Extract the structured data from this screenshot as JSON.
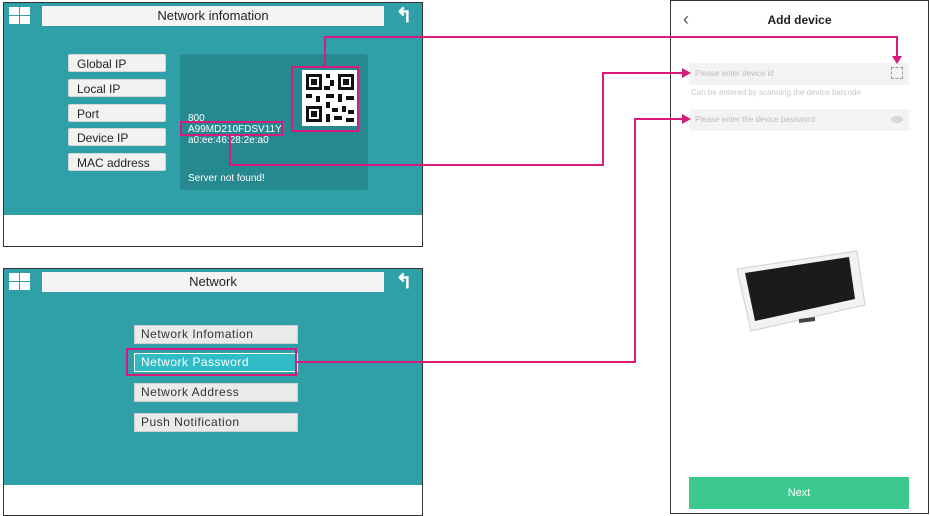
{
  "network_info_screen": {
    "title": "Network infomation",
    "buttons": [
      "Global IP",
      "Local IP",
      "Port",
      "Device IP",
      "MAC address"
    ],
    "info_lines": [
      "800",
      "A99MD210FDSV11Y",
      "a0:ee:46:28:2e:a0"
    ],
    "status": "Server not found!"
  },
  "network_screen": {
    "title": "Network",
    "menu": [
      "Network Infomation",
      "Network Password",
      "Network Address",
      "Push Notification"
    ],
    "active_index": 1
  },
  "phone": {
    "title": "Add device",
    "device_id_placeholder": "Please enter device id",
    "scan_hint": "Can be entered by scanning the device barcode",
    "password_placeholder": "Please enter the device password",
    "next_label": "Next"
  },
  "colors": {
    "teal": "#2fa0a8",
    "highlight": "#d81b7a",
    "next_button": "#3cc98f"
  },
  "icons": {
    "home": "windows-grid-icon",
    "back": "return-arrow-icon",
    "phone_back": "chevron-left-icon",
    "scan": "scan-frame-icon",
    "eye": "eye-icon"
  }
}
